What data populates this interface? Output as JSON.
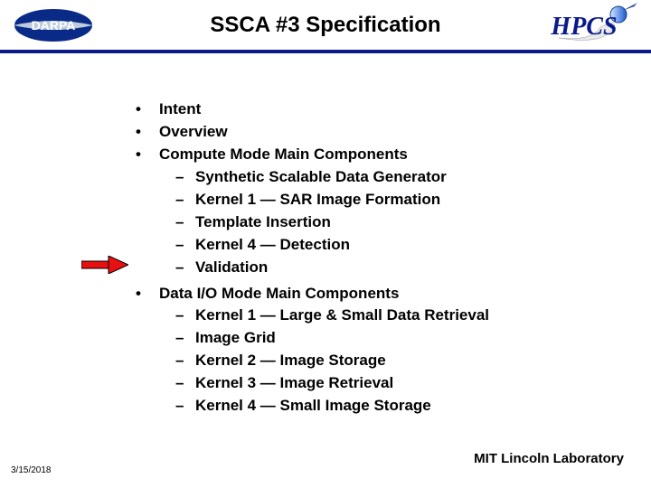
{
  "title": "SSCA #3 Specification",
  "logos": {
    "left_label": "DARPA",
    "right_label": "HPCS"
  },
  "bullets": [
    {
      "label": "Intent",
      "subs": []
    },
    {
      "label": "Overview",
      "subs": []
    },
    {
      "label": "Compute Mode Main Components",
      "subs": [
        "Synthetic Scalable Data Generator",
        "Kernel 1 — SAR Image Formation",
        "Template Insertion",
        "Kernel 4 — Detection",
        "Validation"
      ]
    },
    {
      "label": "Data I/O Mode Main Components",
      "subs": [
        "Kernel 1 — Large & Small Data Retrieval",
        "Image Grid",
        "Kernel 2 — Image Storage",
        "Kernel 3 — Image Retrieval",
        "Kernel 4 — Small Image Storage"
      ]
    }
  ],
  "footer": {
    "right": "MIT Lincoln Laboratory",
    "left": "3/15/2018"
  }
}
